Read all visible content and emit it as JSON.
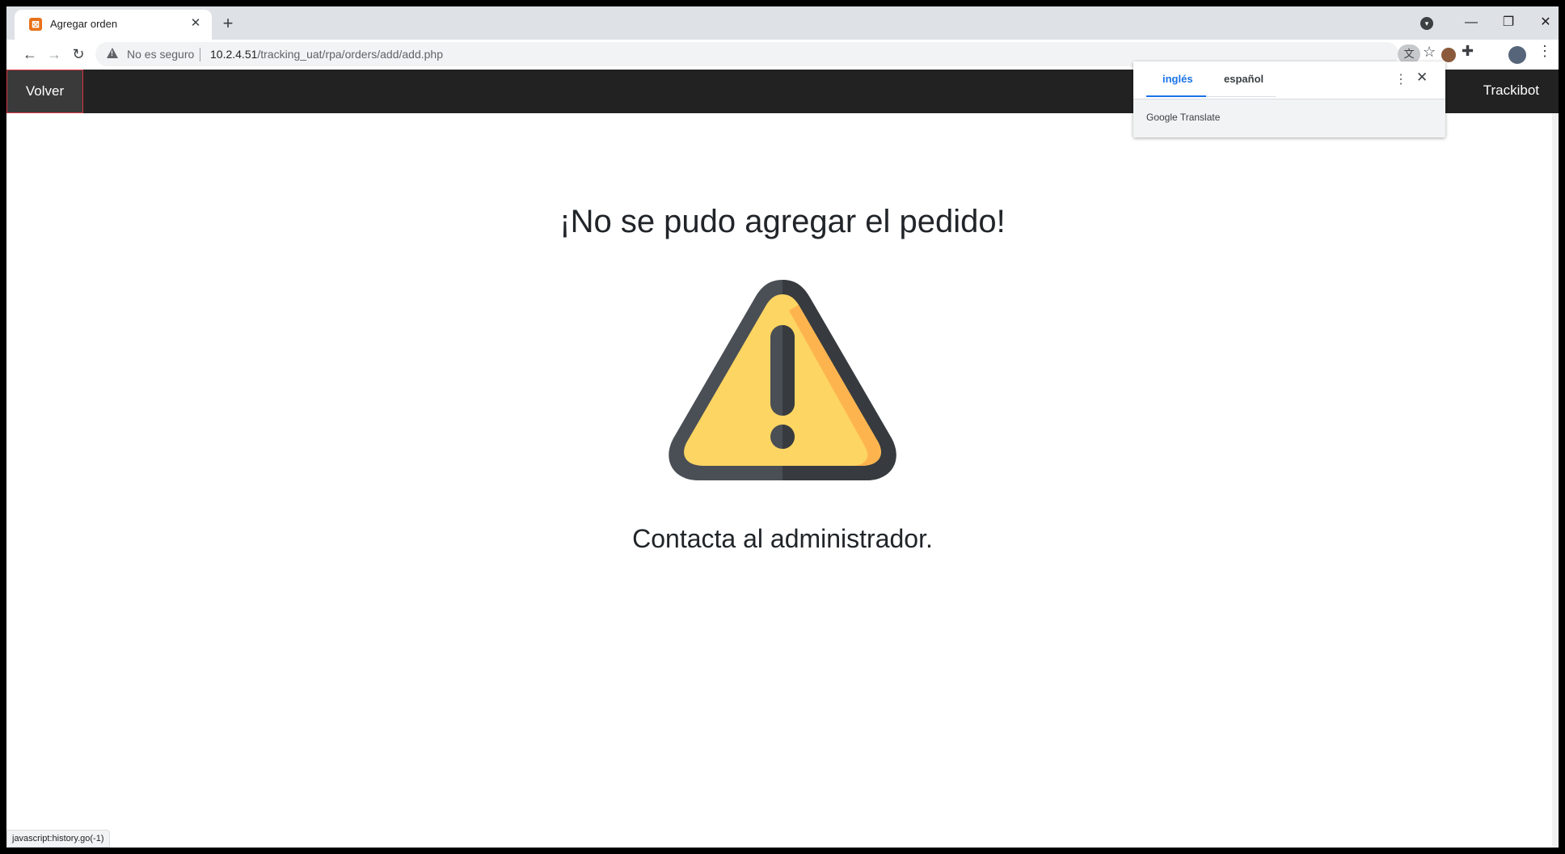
{
  "browser": {
    "tab_title": "Agregar orden",
    "security_label": "No es seguro",
    "url_host": "10.2.4.51",
    "url_path": "/tracking_uat/rpa/orders/add/add.php",
    "status_text": "javascript:history.go(-1)"
  },
  "navbar": {
    "back_label": "Volver",
    "brand": "Trackibot"
  },
  "main": {
    "headline": "¡No se pudo agregar el pedido!",
    "subline": "Contacta al administrador.",
    "warning_colors": {
      "fill": "#fdd562",
      "shade": "#fdb44f",
      "outline": "#4a4f55",
      "outline_dark": "#373b3f"
    }
  },
  "translate_popup": {
    "lang_source": "inglés",
    "lang_target": "español",
    "footer": "Google Translate"
  }
}
